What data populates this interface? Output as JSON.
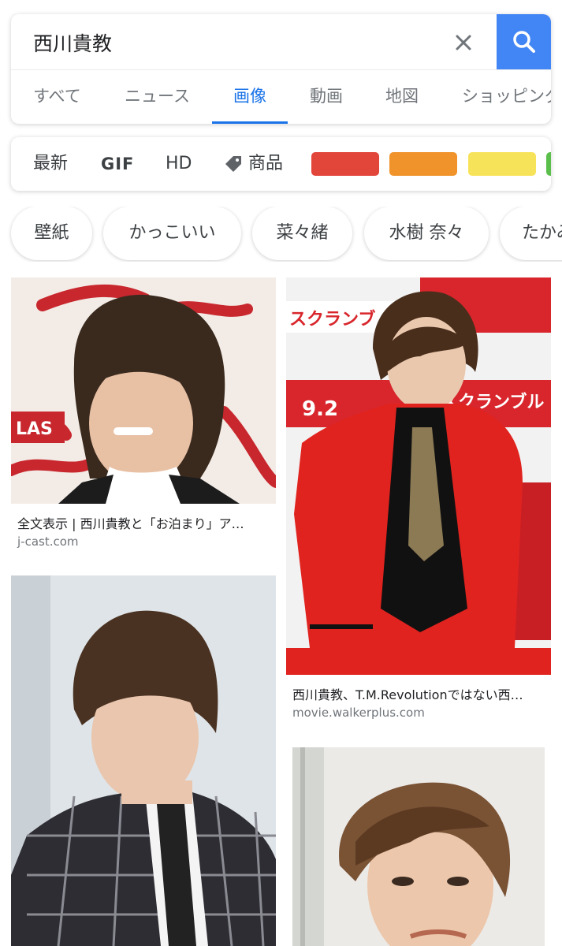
{
  "search": {
    "query": "西川貴教"
  },
  "tabs": [
    {
      "label": "すべて"
    },
    {
      "label": "ニュース"
    },
    {
      "label": "画像"
    },
    {
      "label": "動画"
    },
    {
      "label": "地図"
    },
    {
      "label": "ショッピング"
    }
  ],
  "active_tab": "画像",
  "filters": {
    "latest": "最新",
    "gif": "GIF",
    "hd": "HD",
    "products": "商品",
    "color_swatches": [
      "#e2453a",
      "#f0932b",
      "#f7e35a",
      "#5bbf4c"
    ]
  },
  "chips": [
    {
      "label": "壁紙"
    },
    {
      "label": "かっこいい"
    },
    {
      "label": "菜々緒"
    },
    {
      "label": "水樹 奈々"
    },
    {
      "label": "たかみな"
    }
  ],
  "results": [
    {
      "title": "全文表示 | 西川貴教と「お泊まり」ア…",
      "source": "j-cast.com"
    },
    {
      "title": "西川貴教、T.M.Revolutionではない西…",
      "source": "movie.walkerplus.com"
    },
    {
      "title": "",
      "source": ""
    },
    {
      "title": "",
      "source": ""
    }
  ],
  "colors": {
    "accent": "#1a73e8",
    "search_button": "#4285f4"
  },
  "icons": {
    "clear": "close-icon",
    "search": "search-icon",
    "tag": "tag-icon"
  }
}
